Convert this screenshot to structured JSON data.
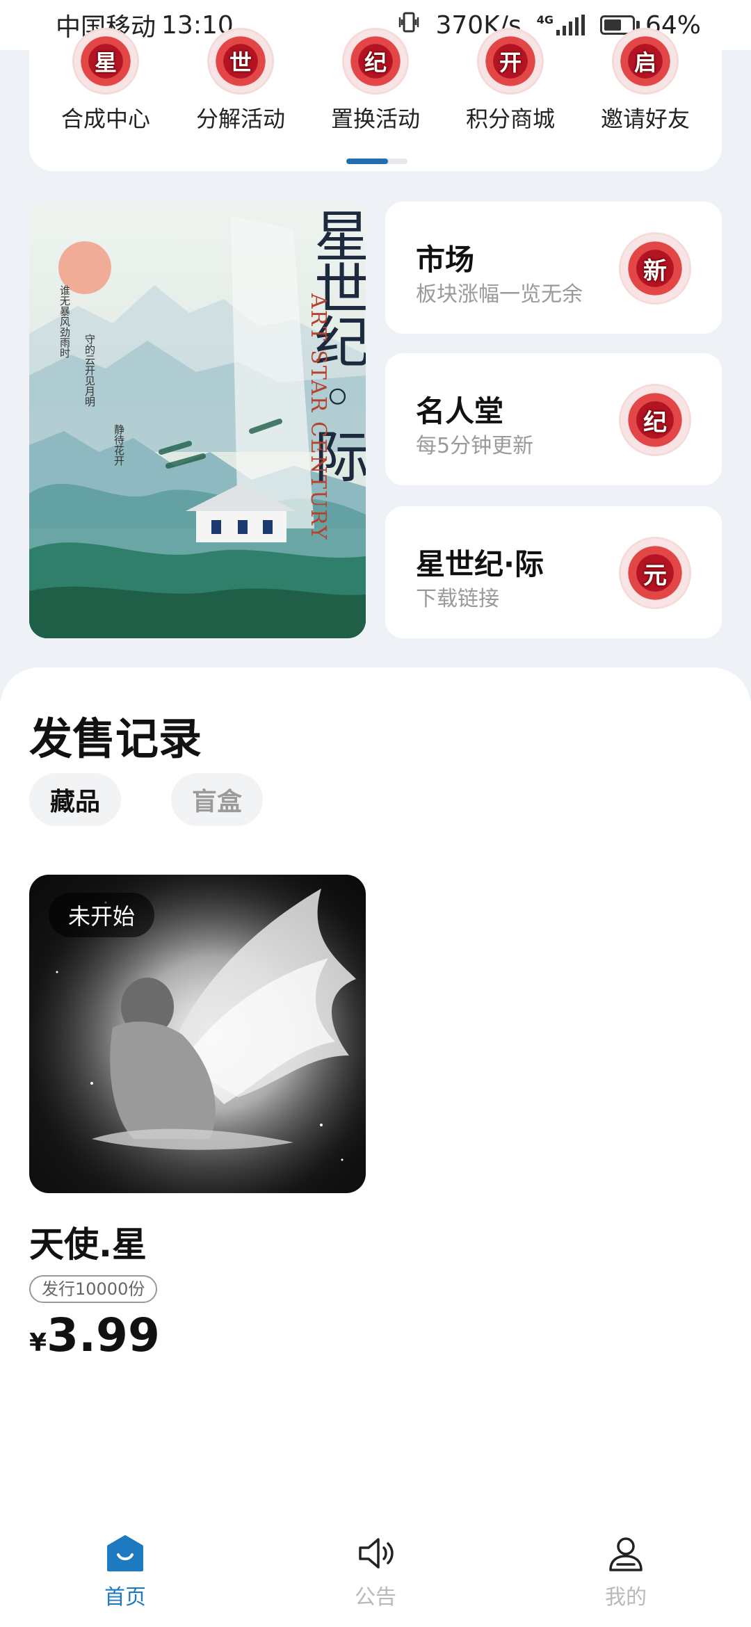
{
  "status_bar": {
    "carrier": "中国移动",
    "time": "13:10",
    "net_speed": "370K/s",
    "network": "4G",
    "battery": "64%",
    "battery_level": 0.64
  },
  "quick_menu": {
    "items": [
      {
        "label": "合成中心",
        "badge": "星"
      },
      {
        "label": "分解活动",
        "badge": "世"
      },
      {
        "label": "置换活动",
        "badge": "纪"
      },
      {
        "label": "积分商城",
        "badge": "开"
      },
      {
        "label": "邀请好友",
        "badge": "启"
      }
    ],
    "page_count": 2,
    "current_page": 1
  },
  "poster": {
    "title": "星世纪◦际",
    "subtitle_en": "ART STAR CENTURY",
    "poem": [
      "谁无暴风劲雨时",
      "守的云开见月明",
      "静待花开"
    ]
  },
  "features": [
    {
      "title": "市场",
      "subtitle": "板块涨幅一览无余",
      "badge": "新"
    },
    {
      "title": "名人堂",
      "subtitle": "每5分钟更新",
      "badge": "纪"
    },
    {
      "title": "星世纪·际",
      "subtitle": "下载链接",
      "badge": "元"
    }
  ],
  "sales": {
    "title": "发售记录",
    "tabs": [
      {
        "label": "藏品",
        "active": true
      },
      {
        "label": "盲盒",
        "active": false
      }
    ],
    "products": [
      {
        "name": "天使.星",
        "status": "未开始",
        "issue": "发行10000份",
        "currency": "¥",
        "price": "3.99"
      }
    ]
  },
  "bottom_nav": {
    "items": [
      {
        "label": "首页",
        "icon": "home-icon",
        "active": true
      },
      {
        "label": "公告",
        "icon": "speaker-icon",
        "active": false
      },
      {
        "label": "我的",
        "icon": "user-icon",
        "active": false
      }
    ]
  },
  "colors": {
    "accent": "#1e7ac0",
    "indicator": "#1e6eb0",
    "background": "#eef2f7",
    "medal_red": "#b31322"
  }
}
